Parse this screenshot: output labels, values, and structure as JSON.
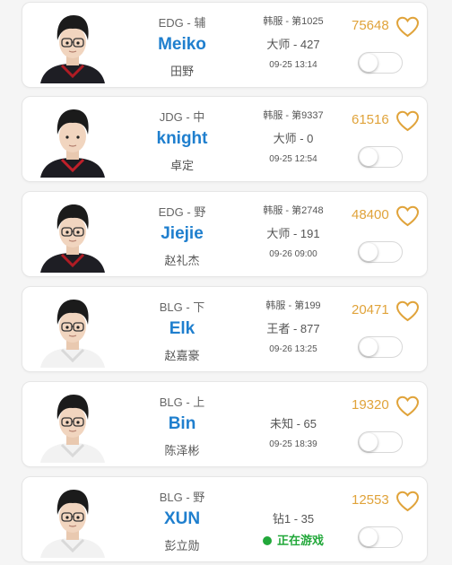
{
  "colors": {
    "accent_blue": "#1f7fce",
    "like_gold": "#e0a33a",
    "live_green": "#22a83a"
  },
  "players": [
    {
      "team_pos": "EDG - 辅",
      "name": "Meiko",
      "real_name": "田野",
      "server": "韩服 - 第1025",
      "rank": "大师 - 427",
      "time": "09-25 13:14",
      "likes": "75648",
      "favorited": false,
      "follow_on": false,
      "jersey": "#1e1e24",
      "jersey_accent": "#b01c24",
      "glasses": true
    },
    {
      "team_pos": "JDG - 中",
      "name": "knight",
      "real_name": "卓定",
      "server": "韩服 - 第9337",
      "rank": "大师 - 0",
      "time": "09-25 12:54",
      "likes": "61516",
      "favorited": false,
      "follow_on": false,
      "jersey": "#1c1c22",
      "jersey_accent": "#c0202a",
      "glasses": false
    },
    {
      "team_pos": "EDG - 野",
      "name": "Jiejie",
      "real_name": "赵礼杰",
      "server": "韩服 - 第2748",
      "rank": "大师 - 191",
      "time": "09-26 09:00",
      "likes": "48400",
      "favorited": false,
      "follow_on": false,
      "jersey": "#1e1e24",
      "jersey_accent": "#b01c24",
      "glasses": true
    },
    {
      "team_pos": "BLG - 下",
      "name": "Elk",
      "real_name": "赵嘉豪",
      "server": "韩服 - 第199",
      "rank": "王者 - 877",
      "time": "09-26 13:25",
      "likes": "20471",
      "favorited": false,
      "follow_on": false,
      "jersey": "#f2f2f2",
      "jersey_accent": "#d9d9d9",
      "glasses": true
    },
    {
      "team_pos": "BLG - 上",
      "name": "Bin",
      "real_name": "陈泽彬",
      "server": "",
      "rank": "未知 - 65",
      "time": "09-25 18:39",
      "likes": "19320",
      "favorited": false,
      "follow_on": false,
      "jersey": "#f2f2f2",
      "jersey_accent": "#d9d9d9",
      "glasses": true
    },
    {
      "team_pos": "BLG - 野",
      "name": "XUN",
      "real_name": "彭立勋",
      "server": "",
      "rank": "钻1 - 35",
      "time": "",
      "live": "正在游戏",
      "likes": "12553",
      "favorited": false,
      "follow_on": false,
      "jersey": "#f2f2f2",
      "jersey_accent": "#d9d9d9",
      "glasses": true
    }
  ]
}
